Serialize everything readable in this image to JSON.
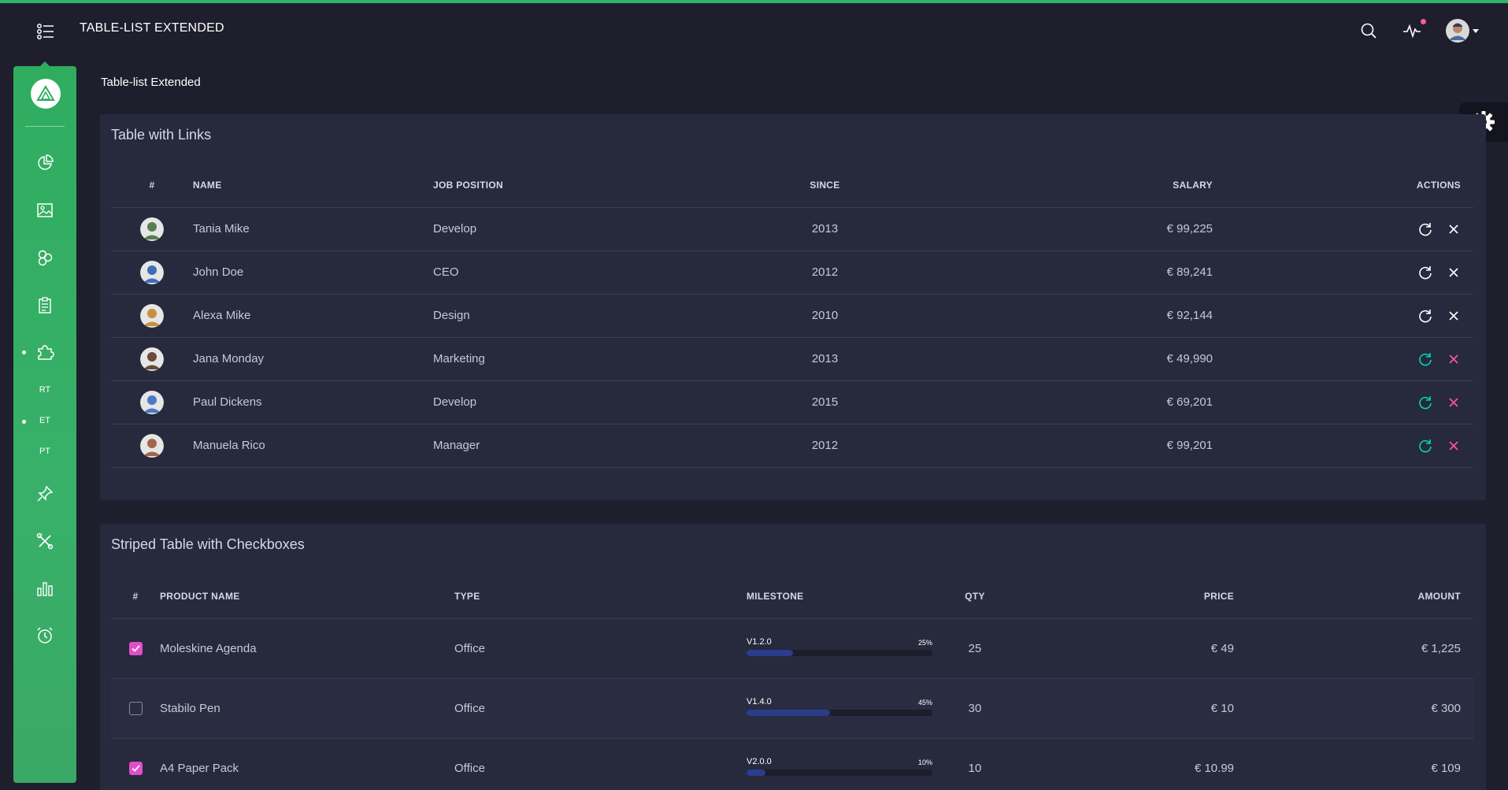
{
  "app": {
    "title": "TABLE-LIST EXTENDED",
    "breadcrumb": "Table-list Extended"
  },
  "colors": {
    "accent_green": "#2fad5f",
    "pink": "#fd5d93",
    "magenta": "#e14eca",
    "teal": "#00d6b4",
    "background": "#1e1e2d",
    "card": "#27293d"
  },
  "topbar": {
    "icons": [
      "list-menu-icon",
      "search-icon",
      "activity-icon",
      "user-avatar"
    ]
  },
  "sidebar": {
    "items": [
      {
        "icon": "pie-chart-icon"
      },
      {
        "icon": "image-icon"
      },
      {
        "icon": "atom-icon"
      },
      {
        "icon": "clipboard-icon"
      },
      {
        "icon": "puzzle-icon",
        "active": true
      },
      {
        "icon": "pin-icon"
      },
      {
        "icon": "tools-icon"
      },
      {
        "icon": "bar-chart-icon"
      },
      {
        "icon": "alarm-clock-icon"
      }
    ],
    "subitems": [
      {
        "label": "RT",
        "active": false
      },
      {
        "label": "ET",
        "active": true
      },
      {
        "label": "PT",
        "active": false
      }
    ]
  },
  "links_table": {
    "title": "Table with Links",
    "headers": {
      "num": "#",
      "name": "NAME",
      "job": "JOB POSITION",
      "since": "SINCE",
      "salary": "SALARY",
      "actions": "ACTIONS"
    },
    "rows": [
      {
        "name": "Tania Mike",
        "job": "Develop",
        "since": "2013",
        "salary": "€ 99,225",
        "actions_colored": false,
        "avatar_color": "#5a7d4f"
      },
      {
        "name": "John Doe",
        "job": "CEO",
        "since": "2012",
        "salary": "€ 89,241",
        "actions_colored": false,
        "avatar_color": "#3b6fb6"
      },
      {
        "name": "Alexa Mike",
        "job": "Design",
        "since": "2010",
        "salary": "€ 92,144",
        "actions_colored": false,
        "avatar_color": "#c7903f"
      },
      {
        "name": "Jana Monday",
        "job": "Marketing",
        "since": "2013",
        "salary": "€ 49,990",
        "actions_colored": true,
        "avatar_color": "#6b4a3c"
      },
      {
        "name": "Paul Dickens",
        "job": "Develop",
        "since": "2015",
        "salary": "€ 69,201",
        "actions_colored": true,
        "avatar_color": "#4a7ac4"
      },
      {
        "name": "Manuela Rico",
        "job": "Manager",
        "since": "2012",
        "salary": "€ 99,201",
        "actions_colored": true,
        "avatar_color": "#a5654a"
      }
    ]
  },
  "striped_table": {
    "title": "Striped Table with Checkboxes",
    "headers": {
      "num": "#",
      "product": "PRODUCT NAME",
      "type": "TYPE",
      "milestone": "MILESTONE",
      "qty": "QTY",
      "price": "PRICE",
      "amount": "AMOUNT"
    },
    "rows": [
      {
        "checked": true,
        "product": "Moleskine Agenda",
        "type": "Office",
        "version": "V1.2.0",
        "progress_label": "25%",
        "progress": 0.25,
        "qty": "25",
        "price": "€ 49",
        "amount": "€ 1,225"
      },
      {
        "checked": false,
        "product": "Stabilo Pen",
        "type": "Office",
        "version": "V1.4.0",
        "progress_label": "45%",
        "progress": 0.45,
        "qty": "30",
        "price": "€ 10",
        "amount": "€ 300"
      },
      {
        "checked": true,
        "product": "A4 Paper Pack",
        "type": "Office",
        "version": "V2.0.0",
        "progress_label": "10%",
        "progress": 0.1,
        "qty": "10",
        "price": "€ 10.99",
        "amount": "€ 109"
      }
    ]
  }
}
